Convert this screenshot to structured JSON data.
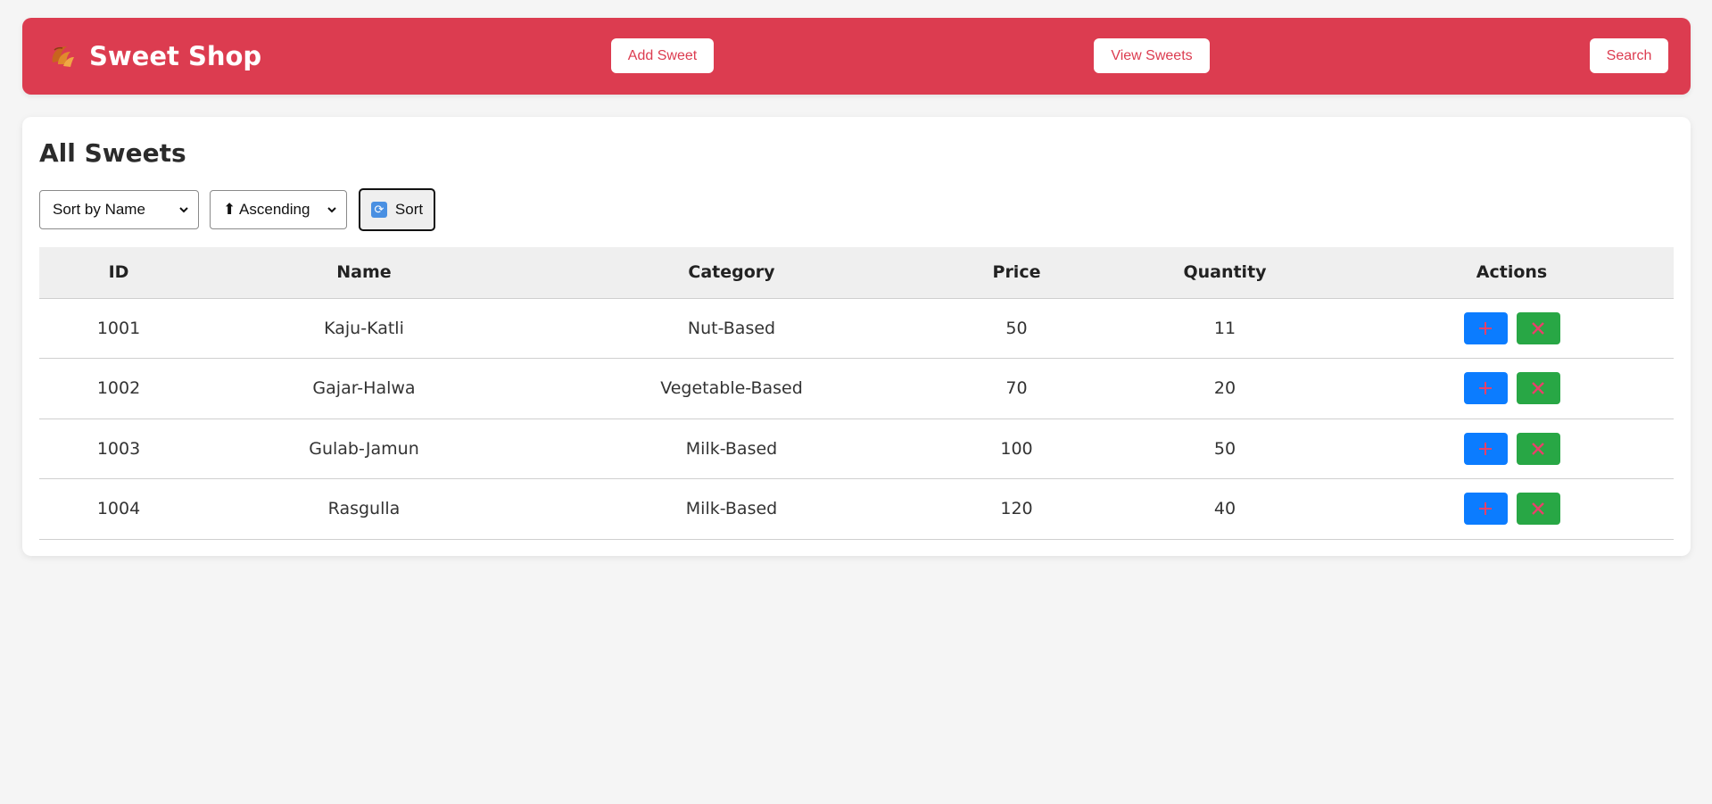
{
  "navbar": {
    "brand": "Sweet Shop",
    "brand_icon": "croissant-icon",
    "links": [
      "Add Sweet",
      "View Sweets",
      "Search"
    ],
    "accent_color": "#dc3c50"
  },
  "main": {
    "title": "All Sweets",
    "sort_field": "Sort by Name",
    "sort_order": "⬆ Ascending",
    "sort_button": "Sort",
    "sort_icon": "refresh-icon"
  },
  "table": {
    "headers": [
      "ID",
      "Name",
      "Category",
      "Price",
      "Quantity",
      "Actions"
    ],
    "rows": [
      {
        "id": "1001",
        "name": "Kaju-Katli",
        "category": "Nut-Based",
        "price": "50",
        "quantity": "11"
      },
      {
        "id": "1002",
        "name": "Gajar-Halwa",
        "category": "Vegetable-Based",
        "price": "70",
        "quantity": "20"
      },
      {
        "id": "1003",
        "name": "Gulab-Jamun",
        "category": "Milk-Based",
        "price": "100",
        "quantity": "50"
      },
      {
        "id": "1004",
        "name": "Rasgulla",
        "category": "Milk-Based",
        "price": "120",
        "quantity": "40"
      }
    ],
    "action_icons": [
      "plus-icon",
      "cross-icon"
    ],
    "action_colors": {
      "add": "#0b7cff",
      "delete": "#28a745",
      "glyph": "#e8416a"
    }
  }
}
